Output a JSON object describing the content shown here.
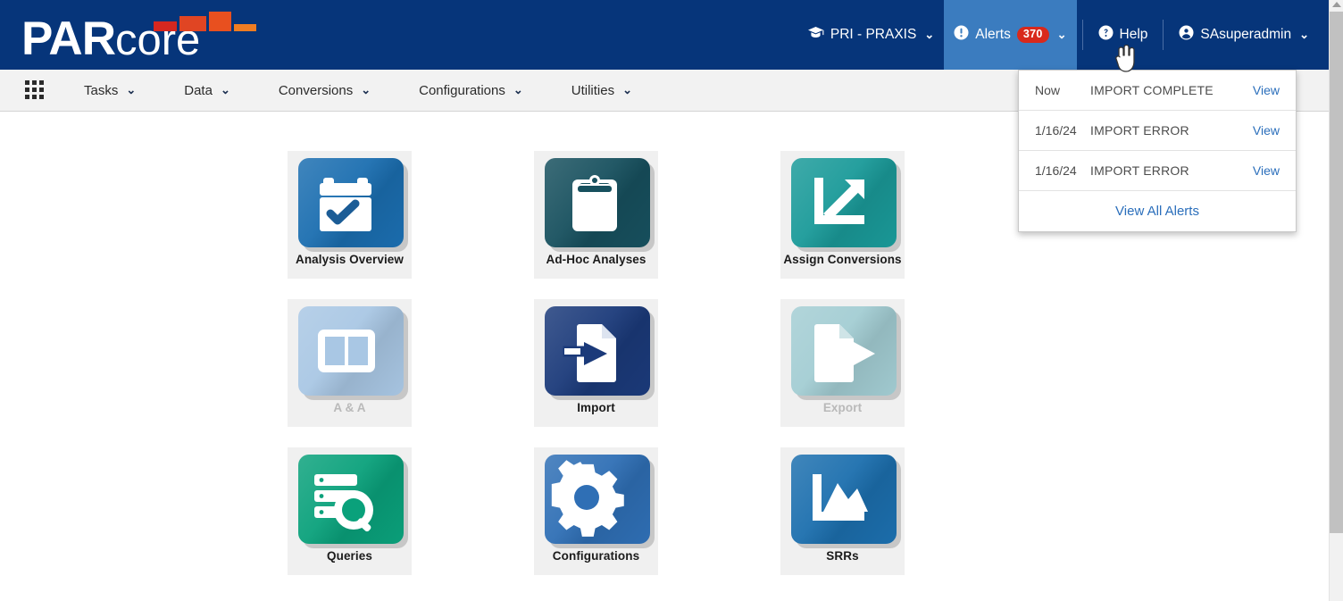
{
  "header": {
    "logo": {
      "bold_text": "PAR",
      "light_text": "core",
      "bar_colors": [
        "#d6271f",
        "#e04523",
        "#e8501f",
        "#ef7d22"
      ]
    },
    "nav": [
      {
        "name": "project-selector",
        "label": "PRI - PRAXIS",
        "icon": "graduation-cap-icon",
        "chevron": "⌄"
      },
      {
        "name": "alerts",
        "label": "Alerts",
        "icon": "exclamation-circle-icon",
        "badge": "370",
        "chevron": "⌄"
      },
      {
        "name": "help",
        "label": "Help",
        "icon": "question-circle-icon"
      },
      {
        "name": "user-menu",
        "label": "SAsuperadmin",
        "icon": "user-circle-icon",
        "chevron": "⌄"
      }
    ],
    "badge_color": "#d8291c",
    "active_bg": "#3b7cbf",
    "bar_color": "#06357a"
  },
  "alerts_dropdown": {
    "rows": [
      {
        "date": "Now",
        "message": "IMPORT COMPLETE",
        "action": "View"
      },
      {
        "date": "1/16/24",
        "message": "IMPORT ERROR",
        "action": "View"
      },
      {
        "date": "1/16/24",
        "message": "IMPORT ERROR",
        "action": "View"
      }
    ],
    "footer_label": "View All Alerts",
    "link_color": "#2a6ebb"
  },
  "menubar": {
    "grid_icon": "apps-grid-icon",
    "items": [
      {
        "label": "Tasks",
        "chevron": "⌄"
      },
      {
        "label": "Data",
        "chevron": "⌄"
      },
      {
        "label": "Conversions",
        "chevron": "⌄"
      },
      {
        "label": "Configurations",
        "chevron": "⌄"
      },
      {
        "label": "Utilities",
        "chevron": "⌄"
      }
    ]
  },
  "tiles": [
    {
      "id": "analysis-overview",
      "label": "Analysis Overview",
      "icon": "calendar-check-icon",
      "color": "#1b6eb0",
      "enabled": true
    },
    {
      "id": "ad-hoc-analyses",
      "label": "Ad-Hoc Analyses",
      "icon": "clipboard-icon",
      "color": "#17505e",
      "enabled": true
    },
    {
      "id": "assign-conversions",
      "label": "Assign Conversions",
      "icon": "axis-arrow-up-icon",
      "color": "#1a9a99",
      "enabled": true
    },
    {
      "id": "a-and-a",
      "label": "A & A",
      "icon": "two-column-layout-icon",
      "color": "#a9c7e4",
      "enabled": false
    },
    {
      "id": "import",
      "label": "Import",
      "icon": "document-arrow-in-icon",
      "color": "#1b3a7a",
      "enabled": true
    },
    {
      "id": "export",
      "label": "Export",
      "icon": "document-arrow-out-icon",
      "color": "#a3cdd3",
      "enabled": false
    },
    {
      "id": "queries",
      "label": "Queries",
      "icon": "database-search-icon",
      "color": "#0aa17b",
      "enabled": true
    },
    {
      "id": "configurations",
      "label": "Configurations",
      "icon": "gear-icon",
      "color": "#2f6fb5",
      "enabled": true
    },
    {
      "id": "srrs",
      "label": "SRRs",
      "icon": "area-chart-icon",
      "color": "#1c6fae",
      "enabled": true
    }
  ]
}
